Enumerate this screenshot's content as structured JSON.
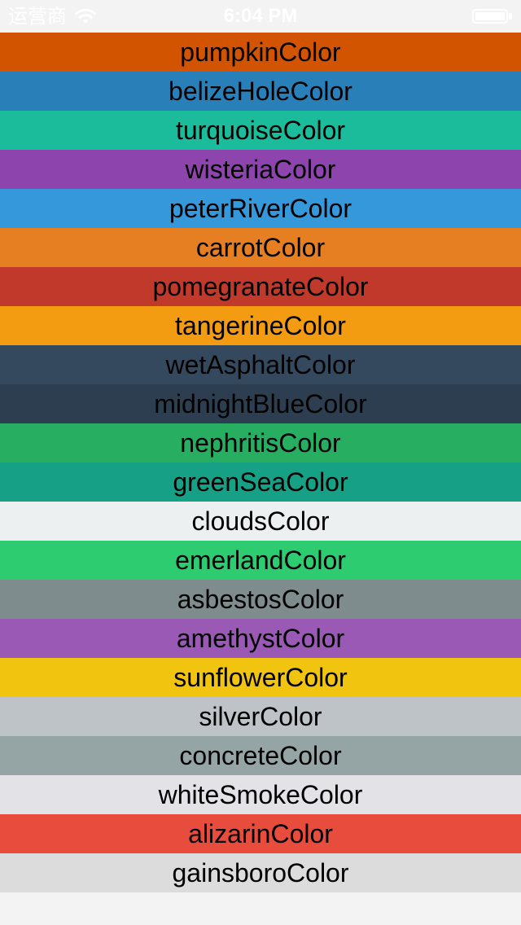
{
  "status_bar": {
    "carrier": "运营商",
    "time": "6:04 PM",
    "wifi_icon": "wifi-icon",
    "battery_icon": "battery-icon"
  },
  "colors": [
    {
      "label": "pumpkinColor",
      "hex": "#d35400"
    },
    {
      "label": "belizeHoleColor",
      "hex": "#2980b9"
    },
    {
      "label": "turquoiseColor",
      "hex": "#1abc9c"
    },
    {
      "label": "wisteriaColor",
      "hex": "#8e44ad"
    },
    {
      "label": "peterRiverColor",
      "hex": "#3498db"
    },
    {
      "label": "carrotColor",
      "hex": "#e67e22"
    },
    {
      "label": "pomegranateColor",
      "hex": "#c0392b"
    },
    {
      "label": "tangerineColor",
      "hex": "#f39c12"
    },
    {
      "label": "wetAsphaltColor",
      "hex": "#34495e"
    },
    {
      "label": "midnightBlueColor",
      "hex": "#2c3e50"
    },
    {
      "label": "nephritisColor",
      "hex": "#27ae60"
    },
    {
      "label": "greenSeaColor",
      "hex": "#16a085"
    },
    {
      "label": "cloudsColor",
      "hex": "#ecf0f1"
    },
    {
      "label": "emerlandColor",
      "hex": "#2ecc71"
    },
    {
      "label": "asbestosColor",
      "hex": "#7f8c8d"
    },
    {
      "label": "amethystColor",
      "hex": "#9b59b6"
    },
    {
      "label": "sunflowerColor",
      "hex": "#f1c40f"
    },
    {
      "label": "silverColor",
      "hex": "#bdc3c7"
    },
    {
      "label": "concreteColor",
      "hex": "#95a5a6"
    },
    {
      "label": "whiteSmokeColor",
      "hex": "#e2e2e7"
    },
    {
      "label": "alizarinColor",
      "hex": "#e74c3c"
    },
    {
      "label": "gainsboroColor",
      "hex": "#dcdcdc"
    }
  ],
  "page_background": "#f3f3f3"
}
